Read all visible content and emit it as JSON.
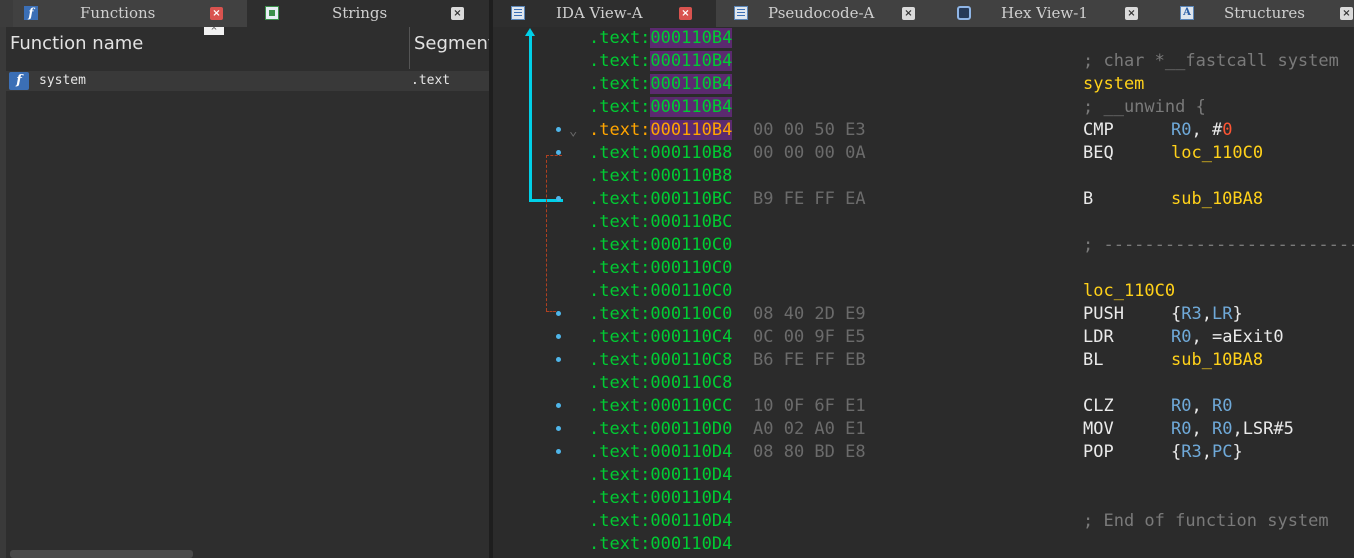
{
  "left_tabs": [
    {
      "label": "Functions",
      "close": "×"
    },
    {
      "label": "Strings",
      "close": "×"
    }
  ],
  "right_tabs": [
    {
      "label": "IDA View-A",
      "close": "×"
    },
    {
      "label": "Pseudocode-A",
      "close": "×"
    },
    {
      "label": "Hex View-1",
      "close": "×"
    },
    {
      "label": "Structures",
      "close": "×"
    }
  ],
  "functions": {
    "col_name": "Function name",
    "col_segment": "Segment",
    "rows": [
      {
        "name": "system",
        "segment": ".text",
        "icon": "f"
      }
    ]
  },
  "disasm": [
    {
      "seg": ".text:",
      "off": "000110B4",
      "bytes": "",
      "text": ""
    },
    {
      "seg": ".text:",
      "off": "000110B4",
      "bytes": "",
      "comment": "; char *__fastcall system"
    },
    {
      "seg": ".text:",
      "off": "000110B4",
      "bytes": "",
      "label": "system"
    },
    {
      "seg": ".text:",
      "off": "000110B4",
      "bytes": "",
      "comment": "; __unwind {"
    },
    {
      "seg": ".text:",
      "off": "000110B4",
      "bytes": "00 00 50 E3",
      "mnem": "CMP",
      "operands": [
        [
          "reg",
          "R0"
        ],
        [
          "plain",
          ", #"
        ],
        [
          "imm",
          "0"
        ]
      ],
      "current": true
    },
    {
      "seg": ".text:",
      "off": "000110B8",
      "bytes": "00 00 00 0A",
      "mnem": "BEQ",
      "operands": [
        [
          "lbl",
          "loc_110C0"
        ]
      ]
    },
    {
      "seg": ".text:",
      "off": "000110B8",
      "bytes": ""
    },
    {
      "seg": ".text:",
      "off": "000110BC",
      "bytes": "B9 FE FF EA",
      "mnem": "B",
      "operands": [
        [
          "lbl",
          "sub_10BA8"
        ]
      ]
    },
    {
      "seg": ".text:",
      "off": "000110BC",
      "bytes": ""
    },
    {
      "seg": ".text:",
      "off": "000110C0",
      "bytes": "",
      "comment": "; -------------------------------"
    },
    {
      "seg": ".text:",
      "off": "000110C0",
      "bytes": ""
    },
    {
      "seg": ".text:",
      "off": "000110C0",
      "bytes": "",
      "label": "loc_110C0"
    },
    {
      "seg": ".text:",
      "off": "000110C0",
      "bytes": "08 40 2D E9",
      "mnem": "PUSH",
      "operands": [
        [
          "plain",
          "{"
        ],
        [
          "reg",
          "R3"
        ],
        [
          "plain",
          ","
        ],
        [
          "reg",
          "LR"
        ],
        [
          "plain",
          "}"
        ]
      ]
    },
    {
      "seg": ".text:",
      "off": "000110C4",
      "bytes": "0C 00 9F E5",
      "mnem": "LDR",
      "operands": [
        [
          "reg",
          "R0"
        ],
        [
          "plain",
          ", =aExit0"
        ]
      ]
    },
    {
      "seg": ".text:",
      "off": "000110C8",
      "bytes": "B6 FE FF EB",
      "mnem": "BL",
      "operands": [
        [
          "lbl",
          "sub_10BA8"
        ]
      ]
    },
    {
      "seg": ".text:",
      "off": "000110C8",
      "bytes": ""
    },
    {
      "seg": ".text:",
      "off": "000110CC",
      "bytes": "10 0F 6F E1",
      "mnem": "CLZ",
      "operands": [
        [
          "reg",
          "R0"
        ],
        [
          "plain",
          ", "
        ],
        [
          "reg",
          "R0"
        ]
      ]
    },
    {
      "seg": ".text:",
      "off": "000110D0",
      "bytes": "A0 02 A0 E1",
      "mnem": "MOV",
      "operands": [
        [
          "reg",
          "R0"
        ],
        [
          "plain",
          ", "
        ],
        [
          "reg",
          "R0"
        ],
        [
          "plain",
          ",LSR#5"
        ]
      ]
    },
    {
      "seg": ".text:",
      "off": "000110D4",
      "bytes": "08 80 BD E8",
      "mnem": "POP",
      "operands": [
        [
          "plain",
          "{"
        ],
        [
          "reg",
          "R3"
        ],
        [
          "plain",
          ","
        ],
        [
          "reg",
          "PC"
        ],
        [
          "plain",
          "}"
        ]
      ]
    },
    {
      "seg": ".text:",
      "off": "000110D4",
      "bytes": ""
    },
    {
      "seg": ".text:",
      "off": "000110D4",
      "bytes": ""
    },
    {
      "seg": ".text:",
      "off": "000110D4",
      "bytes": "",
      "comment": "; End of function system"
    },
    {
      "seg": ".text:",
      "off": "000110D4",
      "bytes": ""
    },
    {
      "seg": ".text:",
      "off": "000110D4",
      "bytes": "",
      "comment": "; -------------------------------"
    }
  ],
  "bullets": [
    4,
    5,
    7,
    12,
    13,
    14,
    16,
    17,
    18
  ],
  "highlight_rows": [
    0,
    1,
    2,
    3,
    4
  ]
}
